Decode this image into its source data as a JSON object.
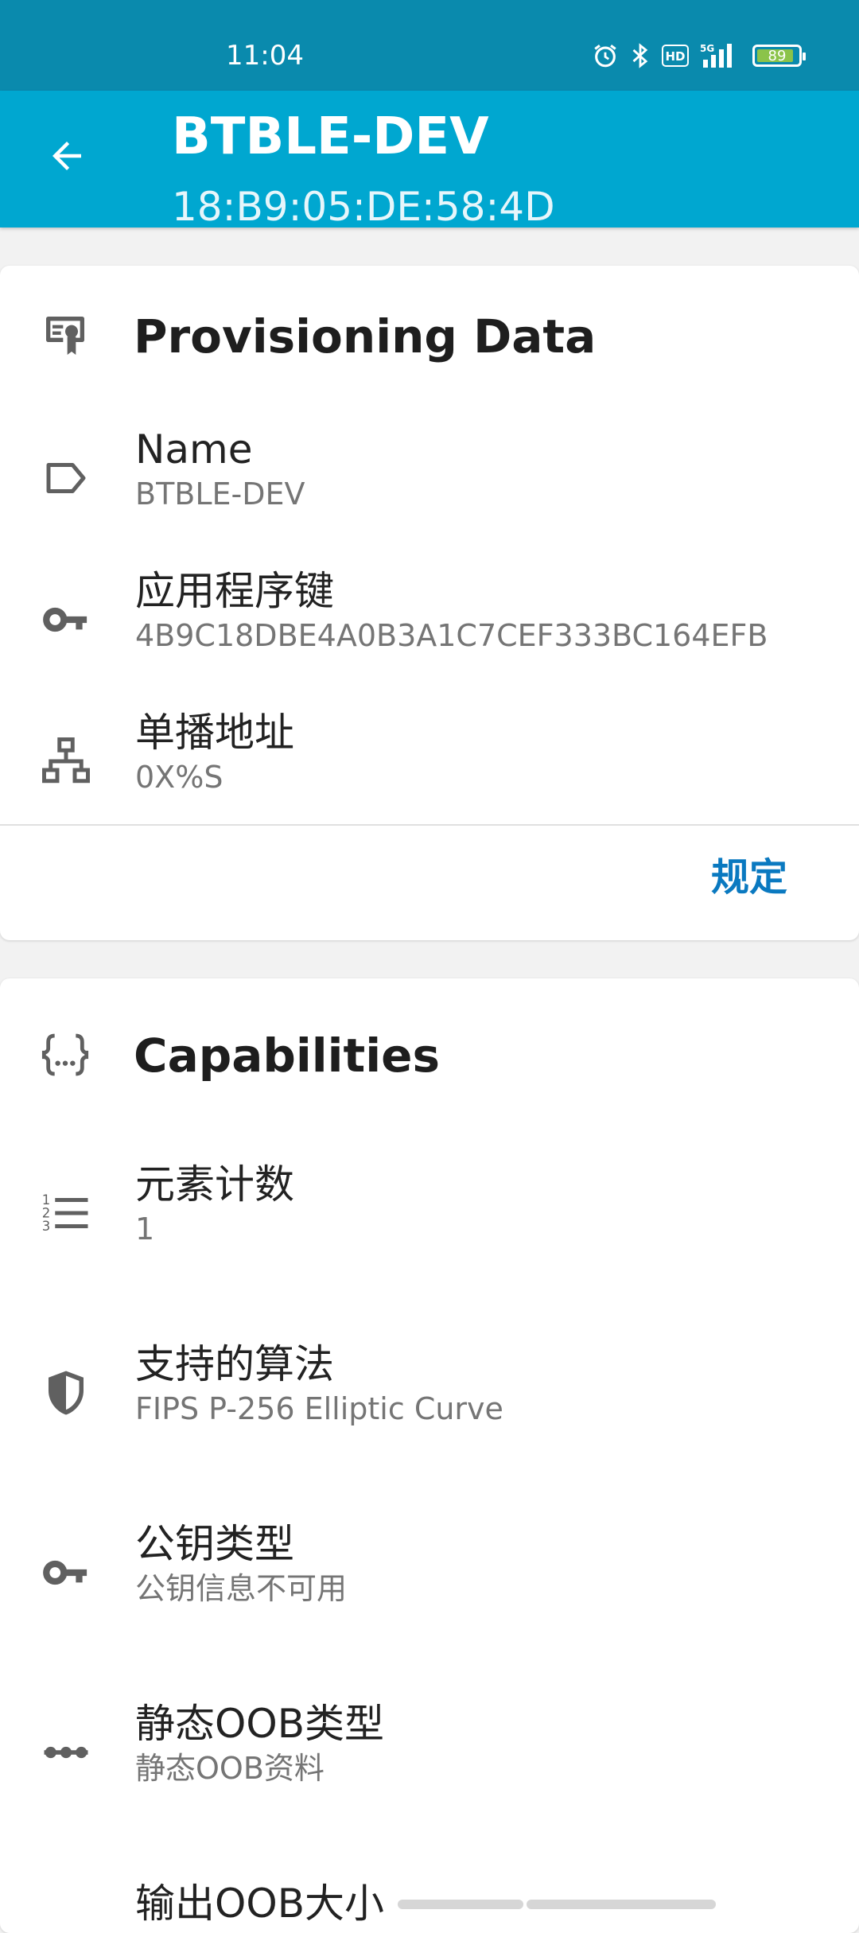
{
  "status_bar": {
    "time": "11:04",
    "battery_level": "89",
    "battery_fraction": 0.89,
    "icons": [
      "alarm-icon",
      "bluetooth-icon",
      "hd-icon",
      "5g-signal-icon",
      "battery-icon"
    ]
  },
  "app_bar": {
    "title": "BTBLE-DEV",
    "subtitle": "18:B9:05:DE:58:4D",
    "back_icon": "arrow-left-icon"
  },
  "provisioning": {
    "header": "Provisioning Data",
    "header_icon": "certificate-icon",
    "rows": [
      {
        "title": "Name",
        "value": "BTBLE-DEV",
        "icon": "label-tag-icon"
      },
      {
        "title": "应用程序键",
        "value": "4B9C18DBE4A0B3A1C7CEF333BC164EFB",
        "icon": "key-icon"
      },
      {
        "title": "单播地址",
        "value": "0X%S",
        "icon": "network-tree-icon"
      }
    ],
    "action_label": "规定"
  },
  "capabilities": {
    "header": "Capabilities",
    "header_icon": "code-braces-icon",
    "rows": [
      {
        "title": "元素计数",
        "value": "1",
        "icon": "numbered-list-icon"
      },
      {
        "title": "支持的算法",
        "value": "FIPS P-256 Elliptic Curve",
        "icon": "shield-icon"
      },
      {
        "title": "公钥类型",
        "value": "公钥信息不可用",
        "icon": "key-icon"
      },
      {
        "title": "静态OOB类型",
        "value": "静态OOB资料",
        "icon": "dots-line-icon"
      },
      {
        "title": "输出OOB大小",
        "value": "",
        "icon": "output-icon"
      }
    ]
  },
  "colors": {
    "status_bar": "#0a8aad",
    "app_bar": "#00a7d0",
    "accent": "#0a79c0",
    "icon": "#606060"
  }
}
